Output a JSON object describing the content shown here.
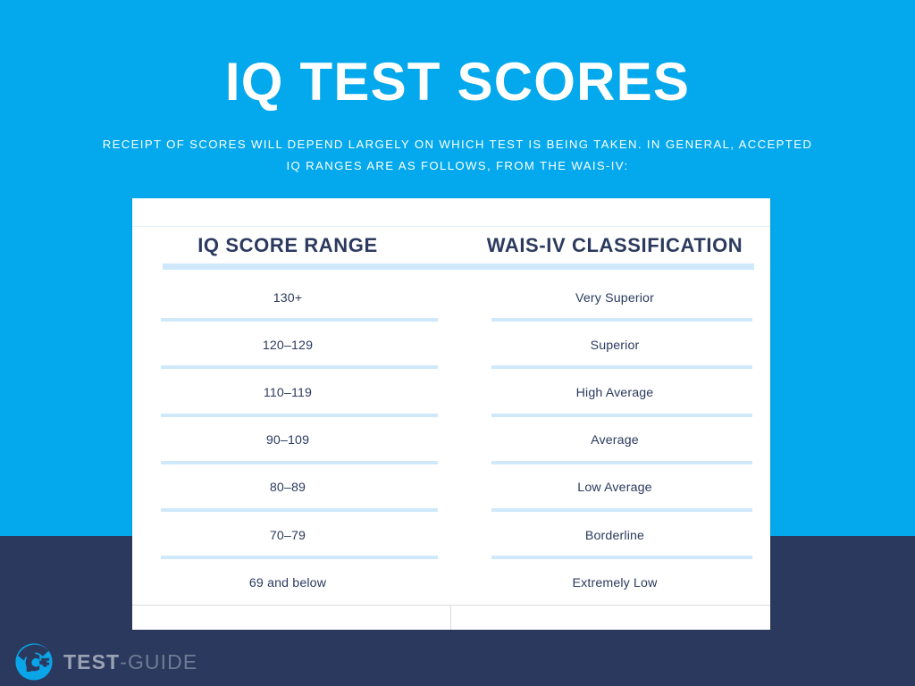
{
  "theme": {
    "background_blue": "#03a9ec",
    "band_navy": "#2b395e",
    "card_white": "#ffffff",
    "text_navy": "#2b3a5e",
    "rule_light_blue": "#cfe9fb",
    "logo_blue": "#09a5e8"
  },
  "header": {
    "title": "IQ TEST SCORES",
    "subtitle": "RECEIPT OF SCORES WILL DEPEND LARGELY ON WHICH TEST IS BEING TAKEN. IN GENERAL, ACCEPTED IQ RANGES ARE AS FOLLOWS, FROM THE WAIS-IV:"
  },
  "footer": {
    "logo_text_bold": "TEST",
    "logo_text_light": "-GUIDE"
  },
  "chart_data": {
    "type": "table",
    "title": "IQ TEST SCORES",
    "columns": [
      "IQ SCORE RANGE",
      "WAIS-IV CLASSIFICATION"
    ],
    "rows": [
      [
        "130+",
        "Very Superior"
      ],
      [
        "120–129",
        "Superior"
      ],
      [
        "110–119",
        "High Average"
      ],
      [
        "90–109",
        "Average"
      ],
      [
        "80–89",
        "Low Average"
      ],
      [
        "70–79",
        "Borderline"
      ],
      [
        "69 and below",
        "Extremely Low"
      ]
    ]
  }
}
